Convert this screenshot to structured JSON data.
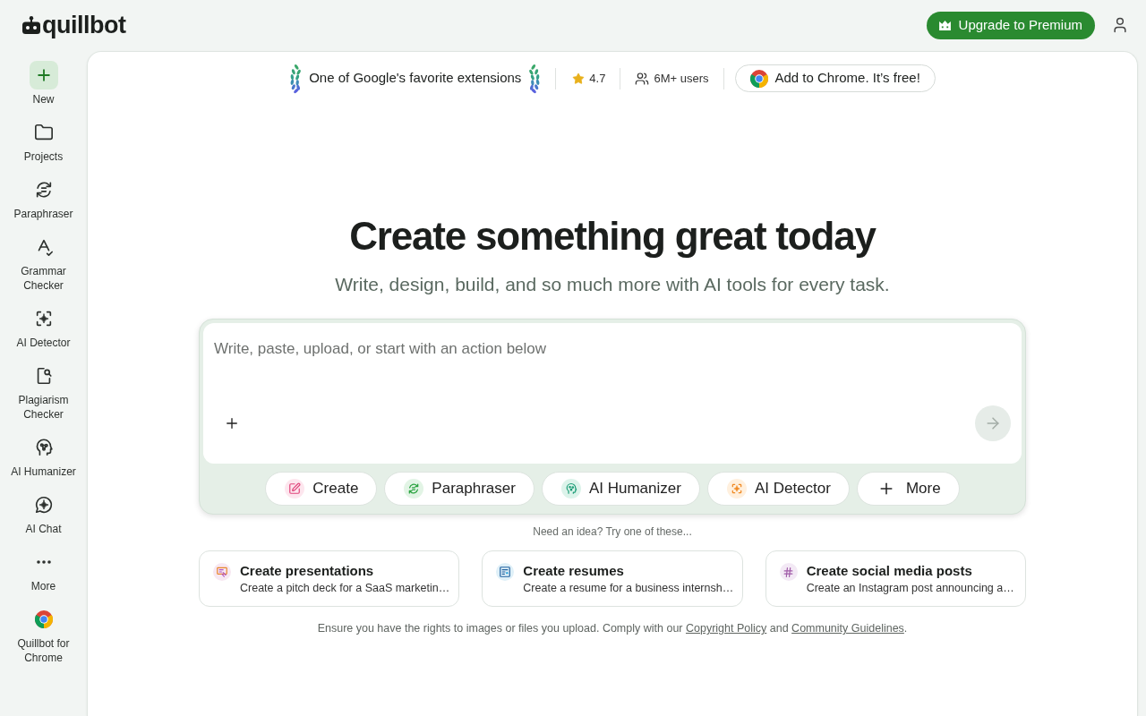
{
  "header": {
    "logo": "quillbot",
    "upgrade_button": "Upgrade to Premium"
  },
  "sidebar": {
    "items": [
      {
        "kind": "new",
        "label": "New"
      },
      {
        "kind": "tool",
        "label": "Projects"
      },
      {
        "kind": "tool",
        "label": "Paraphraser"
      },
      {
        "kind": "tool",
        "label": "Grammar Checker"
      },
      {
        "kind": "tool",
        "label": "AI Detector"
      },
      {
        "kind": "tool",
        "label": "Plagiarism Checker"
      },
      {
        "kind": "tool",
        "label": "AI Humanizer"
      },
      {
        "kind": "tool",
        "label": "AI Chat"
      },
      {
        "kind": "tool",
        "label": "More"
      },
      {
        "kind": "tool",
        "label": "Quillbot for Chrome"
      }
    ]
  },
  "promo_bar": {
    "badge": "One of Google's favorite extensions",
    "rating": "4.7",
    "users": "6M+ users",
    "chrome_button": "Add to Chrome. It’s free!"
  },
  "hero": {
    "title": "Create something great today",
    "subtitle": "Write, design, build, and so much more with AI tools for every task."
  },
  "composer": {
    "placeholder": "Write, paste, upload, or start with an action below",
    "send_button": {
      "disabled": true
    },
    "actions": [
      {
        "kind": "tool",
        "label": "Create"
      },
      {
        "kind": "tool",
        "label": "Paraphraser"
      },
      {
        "kind": "tool",
        "label": "AI Humanizer"
      },
      {
        "kind": "tool",
        "label": "AI Detector"
      },
      {
        "kind": "more",
        "label": "More"
      }
    ]
  },
  "suggestions": {
    "hint": "Need an idea? Try one of these...",
    "cards": [
      {
        "title": "Create presentations",
        "description": "Create a pitch deck for a SaaS marketin…"
      },
      {
        "title": "Create resumes",
        "description": "Create a resume for a business internsh…"
      },
      {
        "title": "Create social media posts",
        "description": "Create an Instagram post announcing a…"
      }
    ]
  },
  "legal_note": [
    {
      "kind": "text",
      "text": "Ensure you have the rights to images or files you upload. Comply with our "
    },
    {
      "kind": "link",
      "text": "Copyright Policy"
    },
    {
      "kind": "text",
      "text": " and "
    },
    {
      "kind": "link",
      "text": "Community Guidelines"
    },
    {
      "kind": "text",
      "text": "."
    }
  ]
}
